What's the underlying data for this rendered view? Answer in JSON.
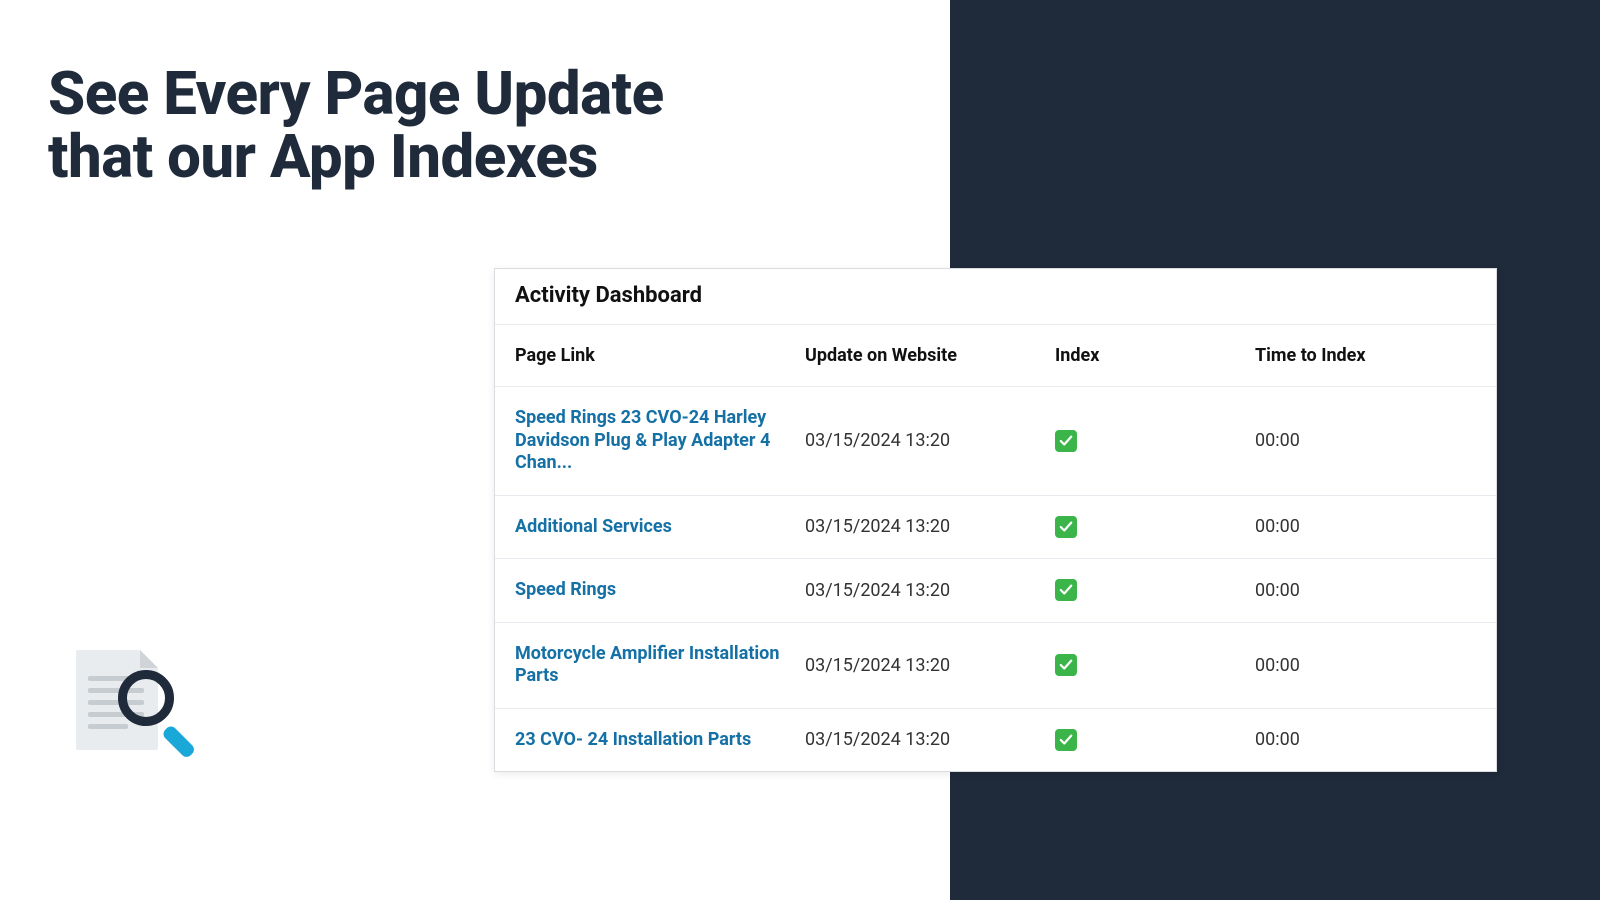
{
  "headline_line1": "See Every Page Update",
  "headline_line2": "that our App Indexes",
  "dashboard": {
    "title": "Activity Dashboard",
    "columns": {
      "page": "Page Link",
      "update": "Update on Website",
      "index": "Index",
      "time": "Time to Index"
    },
    "rows": [
      {
        "page": "Speed Rings 23 CVO-24 Harley Davidson Plug & Play Adapter 4 Chan...",
        "update": "03/15/2024 13:20",
        "indexed": true,
        "time": "00:00"
      },
      {
        "page": "Additional Services",
        "update": "03/15/2024 13:20",
        "indexed": true,
        "time": "00:00"
      },
      {
        "page": "Speed Rings",
        "update": "03/15/2024 13:20",
        "indexed": true,
        "time": "00:00"
      },
      {
        "page": "Motorcycle Amplifier Installation Parts",
        "update": "03/15/2024 13:20",
        "indexed": true,
        "time": "00:00"
      },
      {
        "page": "23 CVO- 24 Installation Parts",
        "update": "03/15/2024 13:20",
        "indexed": true,
        "time": "00:00"
      }
    ]
  }
}
